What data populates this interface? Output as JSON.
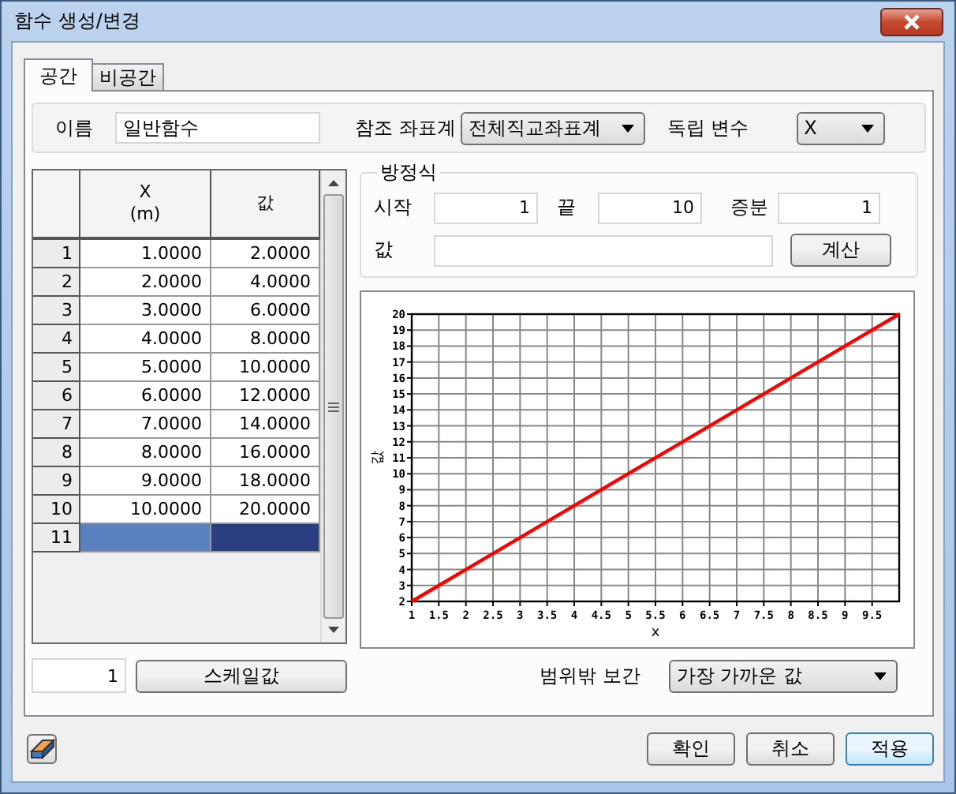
{
  "window": {
    "title": "함수 생성/변경"
  },
  "tabs": [
    {
      "label": "공간",
      "selected": true
    },
    {
      "label": "비공간",
      "selected": false
    }
  ],
  "name_field": {
    "label": "이름",
    "value": "일반함수"
  },
  "coordinate_system": {
    "label": "참조 좌표계",
    "value": "전체직교좌표계"
  },
  "independent_variable": {
    "label": "독립 변수",
    "value": "X"
  },
  "table": {
    "columns": [
      "X\n(m)",
      "값"
    ],
    "rows": [
      {
        "index": "1",
        "cells": [
          "1.0000",
          "2.0000"
        ],
        "selected": false
      },
      {
        "index": "2",
        "cells": [
          "2.0000",
          "4.0000"
        ],
        "selected": false
      },
      {
        "index": "3",
        "cells": [
          "3.0000",
          "6.0000"
        ],
        "selected": false
      },
      {
        "index": "4",
        "cells": [
          "4.0000",
          "8.0000"
        ],
        "selected": false
      },
      {
        "index": "5",
        "cells": [
          "5.0000",
          "10.0000"
        ],
        "selected": false
      },
      {
        "index": "6",
        "cells": [
          "6.0000",
          "12.0000"
        ],
        "selected": false
      },
      {
        "index": "7",
        "cells": [
          "7.0000",
          "14.0000"
        ],
        "selected": false
      },
      {
        "index": "8",
        "cells": [
          "8.0000",
          "16.0000"
        ],
        "selected": false
      },
      {
        "index": "9",
        "cells": [
          "9.0000",
          "18.0000"
        ],
        "selected": false
      },
      {
        "index": "10",
        "cells": [
          "10.0000",
          "20.0000"
        ],
        "selected": false
      },
      {
        "index": "11",
        "selected": true
      }
    ]
  },
  "equation": {
    "title": "방정식",
    "start_label": "시작",
    "start": "1",
    "end_label": "끝",
    "end": "10",
    "step_label": "증분",
    "step": "1",
    "value_label": "값",
    "calculate_button": "계산"
  },
  "chart": {
    "chart_data": {
      "type": "line",
      "xlabel": "x",
      "ylabel": "값",
      "x": [
        1,
        2,
        3,
        4,
        5,
        6,
        7,
        8,
        9,
        10
      ],
      "grid": true,
      "series": [
        {
          "color": "#ff0000",
          "values": [
            2,
            4,
            6,
            8,
            10,
            12,
            14,
            16,
            18,
            20
          ]
        }
      ],
      "xlim": [
        1,
        10
      ],
      "ylim": [
        2,
        20
      ],
      "xticks": [
        1,
        1.5,
        2,
        2.5,
        3,
        3.5,
        4,
        4.5,
        5,
        5.5,
        6,
        6.5,
        7,
        7.5,
        8,
        8.5,
        9,
        9.5
      ],
      "yticks": [
        2,
        3,
        4,
        5,
        6,
        7,
        8,
        9,
        10,
        11,
        12,
        13,
        14,
        15,
        16,
        17,
        18,
        19,
        20
      ]
    }
  },
  "scale": {
    "value": "1",
    "button": "스케일값"
  },
  "extrapolation": {
    "label": "범위밖 보간",
    "value": "가장 가까운 값"
  },
  "buttons": [
    {
      "label": "확인",
      "default": false
    },
    {
      "label": "취소",
      "default": false
    },
    {
      "label": "적용",
      "default": true
    }
  ]
}
